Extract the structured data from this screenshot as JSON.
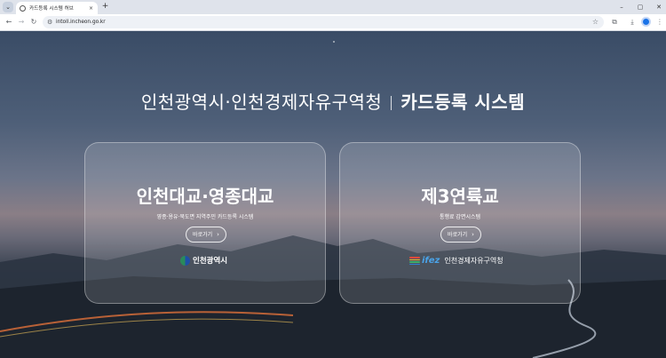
{
  "browser": {
    "tab_title": "카드등록 시스템 허브",
    "tab_close": "×",
    "new_tab": "+",
    "url": "intoll.incheon.go.kr",
    "window_controls": [
      "–",
      "▢",
      "✕"
    ]
  },
  "hero": {
    "organization": "인천광역시·인천경제자유구역청",
    "system_name": "카드등록 시스템"
  },
  "cards": [
    {
      "title": "인천대교·영종대교",
      "subtitle": "영종·용유·북도면 지역주민 카드등록 시스템",
      "button_label": "바로가기",
      "button_icon": "chevron-right-icon",
      "logo_text": "인천광역시"
    },
    {
      "title": "제3연륙교",
      "subtitle": "통행료 감면시스템",
      "button_label": "바로가기",
      "button_icon": "chevron-right-icon",
      "logo_mark": "ifez",
      "logo_text": "인천경제자유구역청"
    }
  ],
  "colors": {
    "ifez_blue": "#4aa3e8",
    "incheon_blue": "#1e4fa6",
    "incheon_green": "#2a8a5b",
    "ifez_stripes": [
      "#e8493b",
      "#f2b632",
      "#3fae6a",
      "#2f7fd1"
    ]
  }
}
